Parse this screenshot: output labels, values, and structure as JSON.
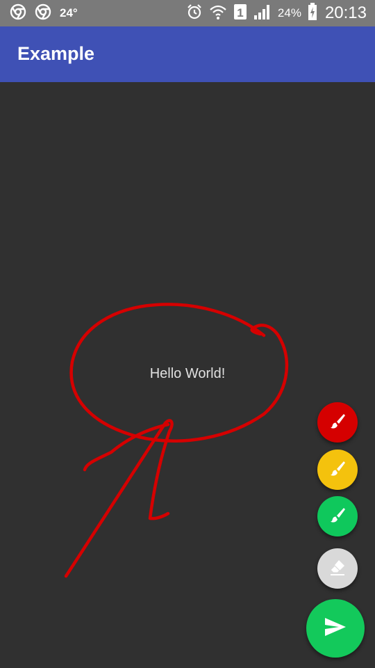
{
  "status_bar": {
    "icons": [
      "chrome-icon",
      "chrome-icon",
      "alarm-icon",
      "wifi-icon",
      "sim-1-icon",
      "signal-icon",
      "battery-charging-icon"
    ],
    "temperature": "24°",
    "sim_slot": "1",
    "battery": "24%",
    "time": "20:13"
  },
  "app_bar": {
    "title": "Example"
  },
  "content": {
    "hello_text": "Hello World!"
  },
  "colors": {
    "app_bar": "#3f51b5",
    "canvas": "#303030",
    "stroke": "#d50000",
    "brush_red": "#d50000",
    "brush_yellow": "#f4c20d",
    "brush_green": "#0fc85c",
    "eraser": "#d9d9d9",
    "send": "#13c95b"
  },
  "fabs": [
    {
      "name": "red-brush-button",
      "icon": "brush-icon"
    },
    {
      "name": "yellow-brush-button",
      "icon": "brush-icon"
    },
    {
      "name": "green-brush-button",
      "icon": "brush-icon"
    },
    {
      "name": "eraser-button",
      "icon": "eraser-icon"
    },
    {
      "name": "send-button",
      "icon": "send-icon"
    }
  ]
}
